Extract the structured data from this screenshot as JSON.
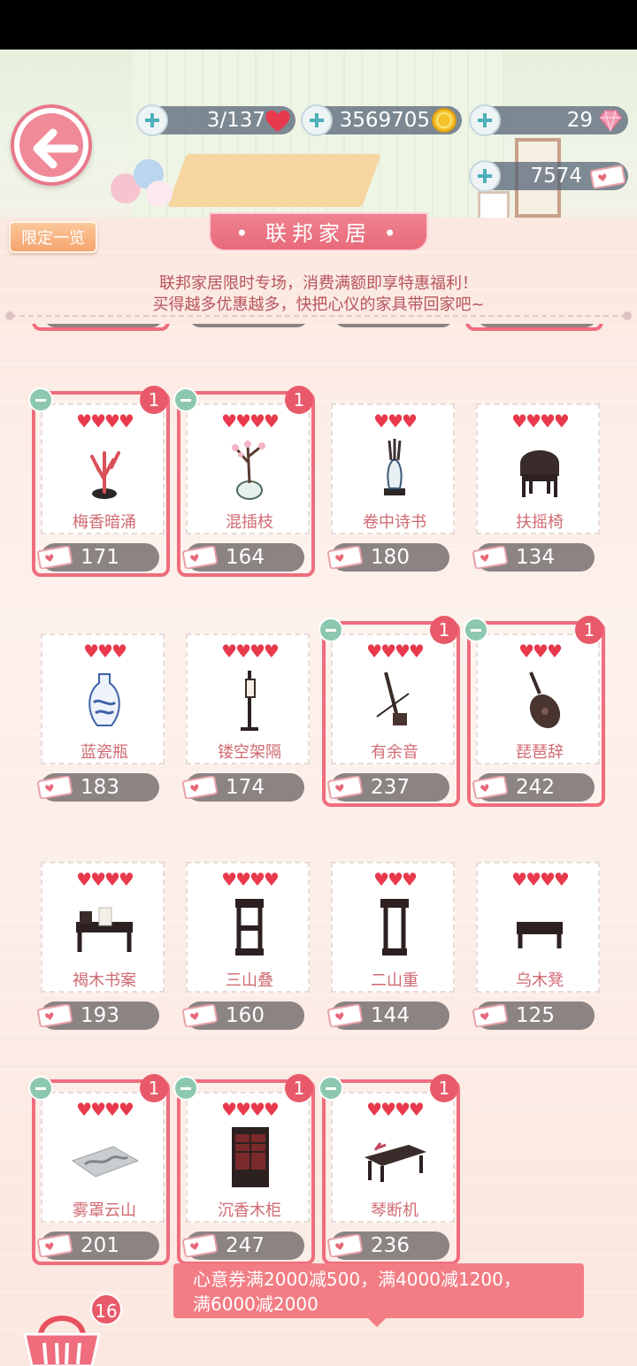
{
  "resources": {
    "hearts": "3/137",
    "coins": "3569705",
    "gems": "29",
    "vouchers": "7574"
  },
  "panel": {
    "limited_button": "限定一览",
    "title": "• 联邦家居 •",
    "intro_line1": "联邦家居限时专场，消费满额即享特惠福利！",
    "intro_line2": "买得越多优惠越多，快把心仪的家具带回家吧~"
  },
  "items": [
    {
      "name": "梅香暗涌",
      "hearts": "♥♥♥♥",
      "price": "171",
      "qty": "1",
      "selected": true,
      "icon": "coral-bonsai-icon"
    },
    {
      "name": "混插枝",
      "hearts": "♥♥♥♥",
      "price": "164",
      "qty": "1",
      "selected": true,
      "icon": "plum-branch-vase-icon"
    },
    {
      "name": "卷中诗书",
      "hearts": "♥♥♥",
      "price": "180",
      "qty": "",
      "selected": false,
      "icon": "scroll-vase-icon"
    },
    {
      "name": "扶摇椅",
      "hearts": "♥♥♥♥",
      "price": "134",
      "qty": "",
      "selected": false,
      "icon": "armchair-icon"
    },
    {
      "name": "蓝瓷瓶",
      "hearts": "♥♥♥",
      "price": "183",
      "qty": "",
      "selected": false,
      "icon": "blue-porcelain-vase-icon"
    },
    {
      "name": "镂空架隔",
      "hearts": "♥♥♥♥",
      "price": "174",
      "qty": "",
      "selected": false,
      "icon": "lantern-stand-icon"
    },
    {
      "name": "有余音",
      "hearts": "♥♥♥♥",
      "price": "237",
      "qty": "1",
      "selected": true,
      "icon": "erhu-icon"
    },
    {
      "name": "琵琶辞",
      "hearts": "♥♥♥",
      "price": "242",
      "qty": "1",
      "selected": true,
      "icon": "pipa-icon"
    },
    {
      "name": "褐木书案",
      "hearts": "♥♥♥♥",
      "price": "193",
      "qty": "",
      "selected": false,
      "icon": "writing-desk-icon"
    },
    {
      "name": "三山叠",
      "hearts": "♥♥♥♥",
      "price": "160",
      "qty": "",
      "selected": false,
      "icon": "three-tier-stand-icon"
    },
    {
      "name": "二山重",
      "hearts": "♥♥♥",
      "price": "144",
      "qty": "",
      "selected": false,
      "icon": "two-tier-stand-icon"
    },
    {
      "name": "乌木凳",
      "hearts": "♥♥♥♥",
      "price": "125",
      "qty": "",
      "selected": false,
      "icon": "stool-icon"
    },
    {
      "name": "雾罩云山",
      "hearts": "♥♥♥♥",
      "price": "201",
      "qty": "1",
      "selected": true,
      "icon": "landscape-rug-icon"
    },
    {
      "name": "沉香木柜",
      "hearts": "♥♥♥♥",
      "price": "247",
      "qty": "1",
      "selected": true,
      "icon": "cabinet-icon"
    },
    {
      "name": "琴断机",
      "hearts": "♥♥♥♥",
      "price": "236",
      "qty": "1",
      "selected": true,
      "icon": "guqin-table-icon"
    }
  ],
  "tip": {
    "line1": "心意券满2000减500，满4000减1200，",
    "line2": "满6000减2000"
  },
  "basket": {
    "count": "16"
  },
  "colors": {
    "accent": "#ef6d7d",
    "price_pill": "#8c8383",
    "heart": "#e8394d"
  }
}
